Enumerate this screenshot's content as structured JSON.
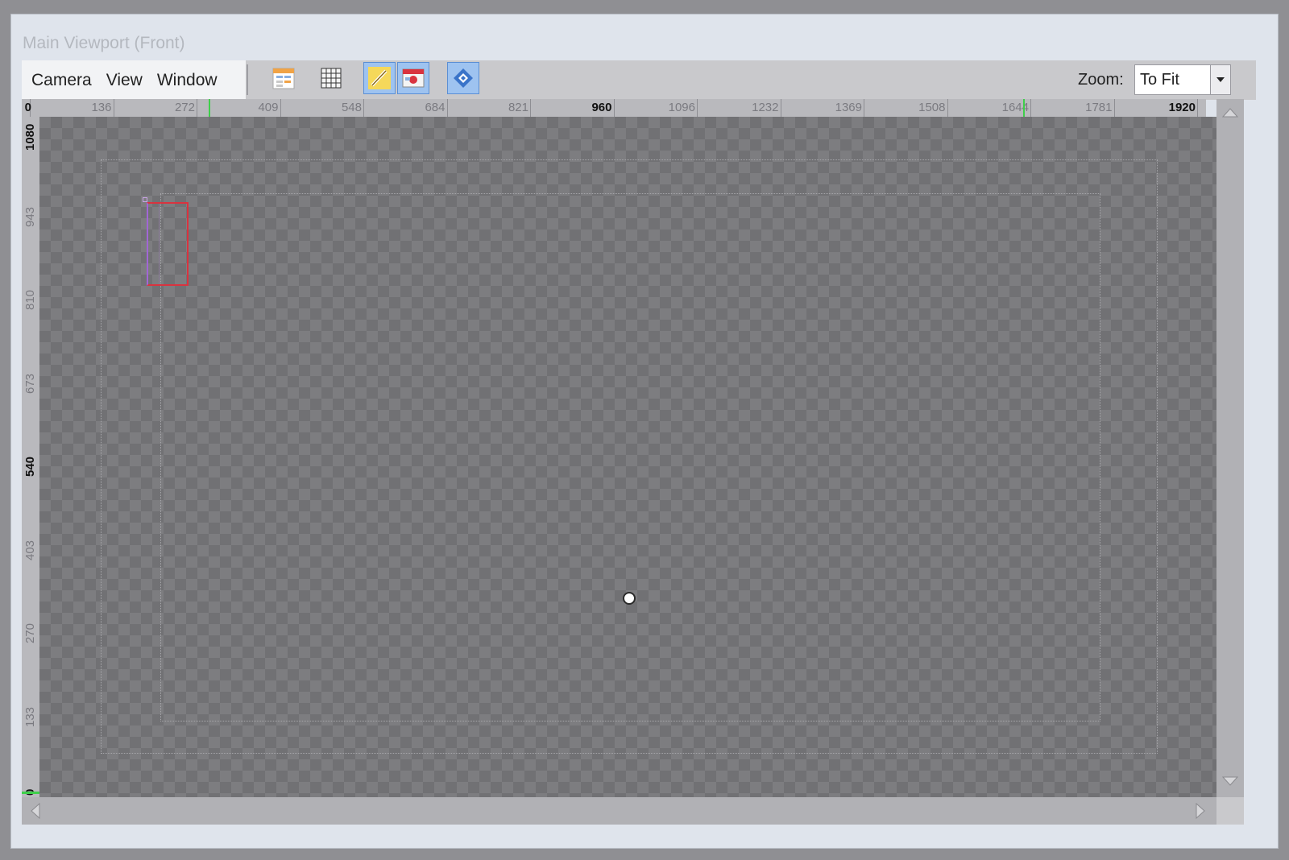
{
  "window": {
    "title": "Main Viewport (Front)"
  },
  "menu": [
    "Camera",
    "View",
    "Window"
  ],
  "toolbar": {
    "tools": [
      {
        "icon": "layout-calendar-icon",
        "active": false
      },
      {
        "icon": "grid-icon",
        "active": false
      },
      {
        "icon": "brush-icon",
        "active": true
      },
      {
        "icon": "camera-view-icon",
        "active": true
      },
      {
        "icon": "navigator-icon",
        "active": true
      }
    ],
    "zoom_label": "Zoom:",
    "zoom_value": "To Fit"
  },
  "rulers": {
    "horizontal": [
      {
        "label": "0",
        "bold": true
      },
      {
        "label": "136",
        "bold": false
      },
      {
        "label": "272",
        "bold": false
      },
      {
        "label": "409",
        "bold": false
      },
      {
        "label": "548",
        "bold": false
      },
      {
        "label": "684",
        "bold": false
      },
      {
        "label": "821",
        "bold": false
      },
      {
        "label": "960",
        "bold": true
      },
      {
        "label": "1096",
        "bold": false
      },
      {
        "label": "1232",
        "bold": false
      },
      {
        "label": "1369",
        "bold": false
      },
      {
        "label": "1508",
        "bold": false
      },
      {
        "label": "1644",
        "bold": false
      },
      {
        "label": "1781",
        "bold": false
      },
      {
        "label": "1920",
        "bold": true
      }
    ],
    "vertical": [
      {
        "label": "1080",
        "bold": true
      },
      {
        "label": "943",
        "bold": false
      },
      {
        "label": "810",
        "bold": false
      },
      {
        "label": "673",
        "bold": false
      },
      {
        "label": "540",
        "bold": true
      },
      {
        "label": "403",
        "bold": false
      },
      {
        "label": "270",
        "bold": false
      },
      {
        "label": "133",
        "bold": false
      },
      {
        "label": "0",
        "bold": true
      }
    ]
  },
  "colors": {
    "selection": "#d9333f",
    "active_tool": "#9ec3f0",
    "ruler_marker": "#3ecf4a"
  }
}
